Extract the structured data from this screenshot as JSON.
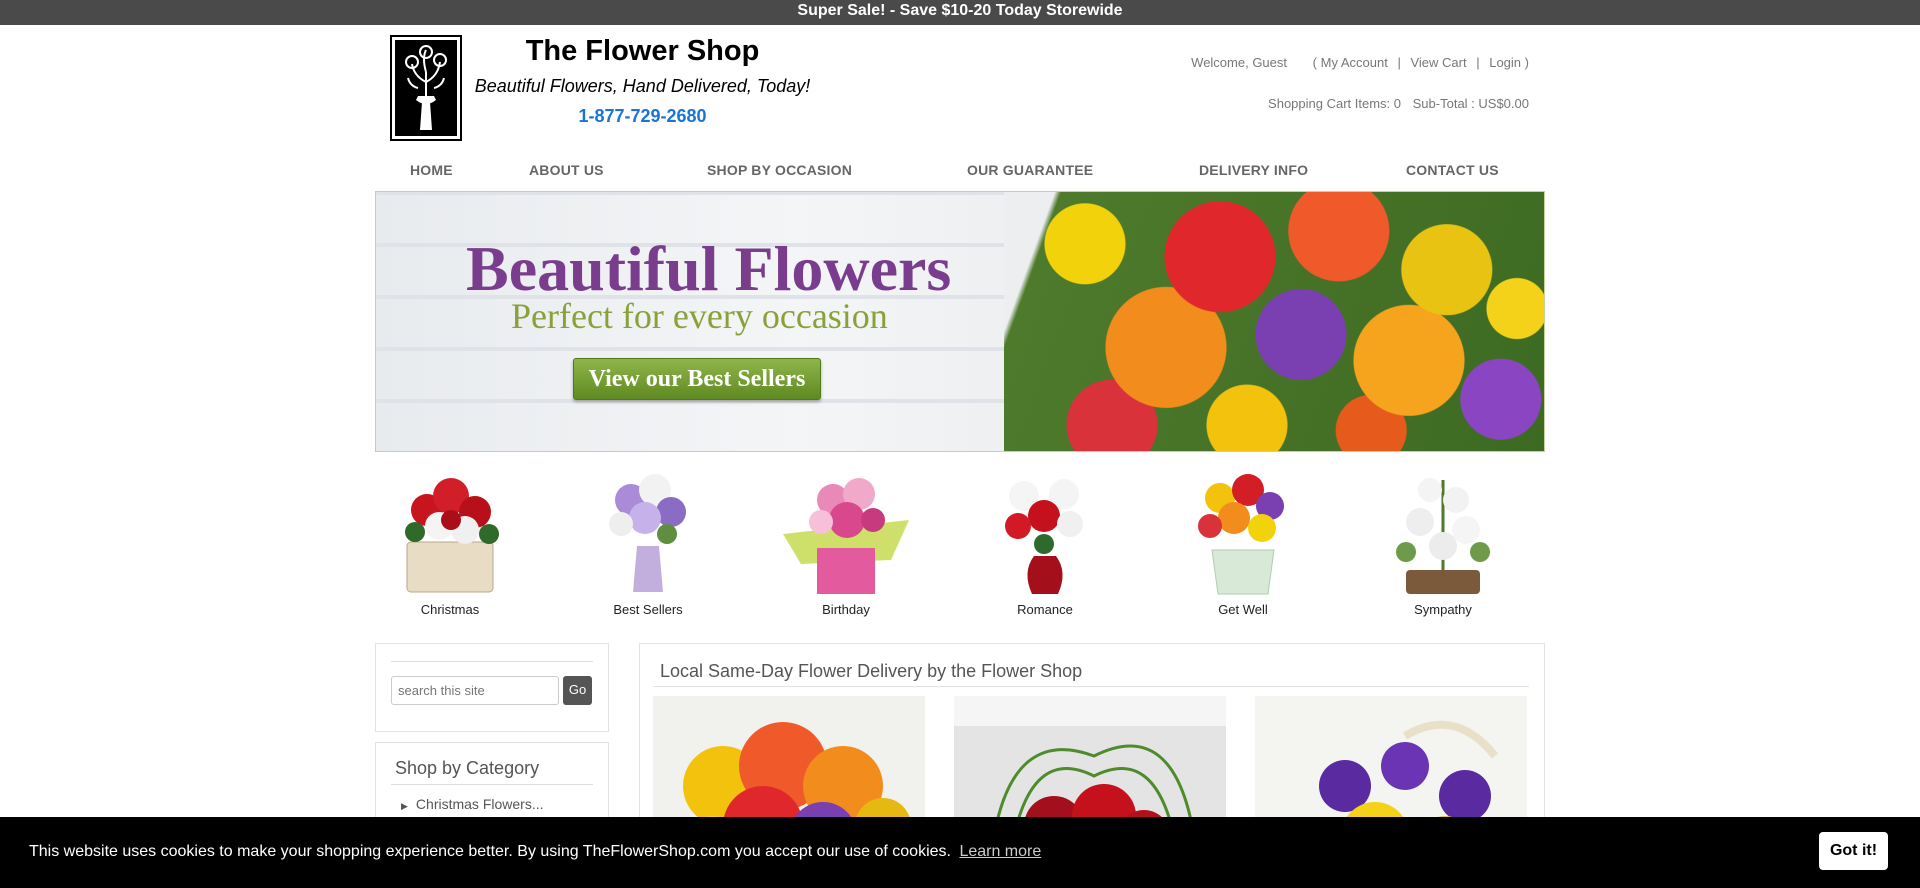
{
  "promo": {
    "text": "Super Sale! - Save $10-20 Today Storewide"
  },
  "brand": {
    "title": "The Flower Shop",
    "tagline": "Beautiful Flowers, Hand Delivered, Today!",
    "phone": "1-877-729-2680"
  },
  "account": {
    "welcome": "Welcome, Guest",
    "open_paren": "(",
    "my_account": "My Account",
    "view_cart": "View Cart",
    "login": "Login",
    "close_paren": ")",
    "cart_items": "Shopping Cart Items: 0",
    "subtotal": "Sub-Total : US$0.00"
  },
  "nav": {
    "home": "HOME",
    "about": "ABOUT US",
    "occasion": "SHOP BY OCCASION",
    "guarantee": "OUR GUARANTEE",
    "delivery": "DELIVERY INFO",
    "contact": "CONTACT US"
  },
  "banner": {
    "title": "Beautiful Flowers",
    "subtitle": "Perfect for every occasion",
    "button": "View our Best Sellers"
  },
  "categories": [
    {
      "label": "Christmas"
    },
    {
      "label": "Best Sellers"
    },
    {
      "label": "Birthday"
    },
    {
      "label": "Romance"
    },
    {
      "label": "Get Well"
    },
    {
      "label": "Sympathy"
    }
  ],
  "search": {
    "placeholder": "search this site",
    "button": "Go"
  },
  "shop_by_category": {
    "title": "Shop by Category",
    "items": [
      "Christmas Flowers..."
    ]
  },
  "main": {
    "title": "Local Same-Day Flower Delivery by the Flower Shop"
  },
  "cookie": {
    "text": "This website uses cookies to make your shopping experience better. By using TheFlowerShop.com you accept our use of cookies.",
    "learn_more": "Learn more",
    "button": "Got it!"
  },
  "colors": {
    "promo_bar": "#4a4a4a",
    "phone": "#1a73d6",
    "nav_text": "#666666",
    "banner_title": "#7a3d8e",
    "banner_sub": "#8aa13a",
    "banner_button": "#6f9a2c",
    "cookie_bar": "#000000"
  },
  "icons": {
    "logo": "flower-vase-logo",
    "category_bullet": "triangle-right-icon"
  }
}
